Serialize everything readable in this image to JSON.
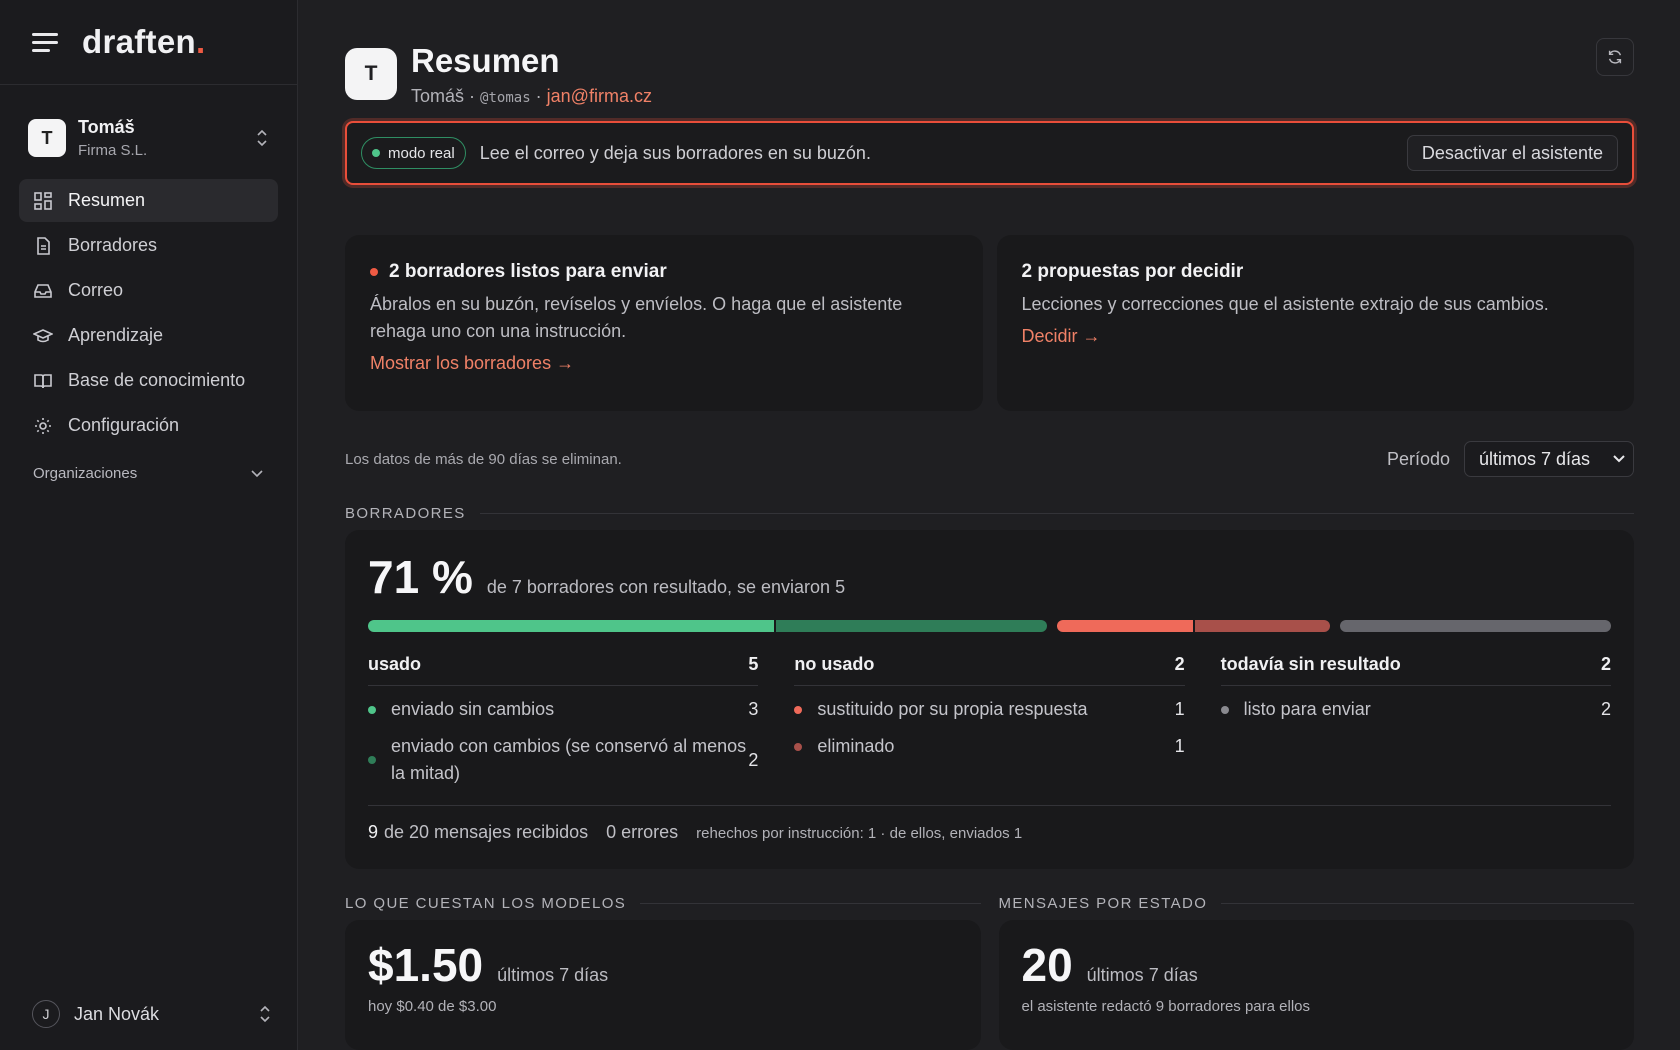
{
  "brand": {
    "name": "draften",
    "dot": "."
  },
  "org": {
    "avatar": "T",
    "name": "Tomáš",
    "company": "Firma S.L."
  },
  "nav": [
    {
      "label": "Resumen",
      "icon": "dashboard-icon"
    },
    {
      "label": "Borradores",
      "icon": "document-icon"
    },
    {
      "label": "Correo",
      "icon": "inbox-icon"
    },
    {
      "label": "Aprendizaje",
      "icon": "graduation-cap-icon"
    },
    {
      "label": "Base de conocimiento",
      "icon": "book-icon"
    },
    {
      "label": "Configuración",
      "icon": "gear-icon"
    }
  ],
  "organizations_label": "Organizaciones",
  "user": {
    "initial": "J",
    "name": "Jan Novák"
  },
  "header": {
    "avatar": "T",
    "title": "Resumen",
    "name": "Tomáš",
    "sep": "·",
    "handle": "@tomas",
    "email": "jan@firma.cz"
  },
  "banner": {
    "mode": "modo real",
    "text": "Lee el correo y deja sus borradores en su buzón.",
    "button": "Desactivar el asistente"
  },
  "cards": [
    {
      "title": "2 borradores listos para enviar",
      "body": "Ábralos en su buzón, revíselos y envíelos. O haga que el asistente rehaga uno con una instrucción.",
      "link": "Mostrar los borradores →"
    },
    {
      "title": "2 propuestas por decidir",
      "body": "Lecciones y correcciones que el asistente extrajo de sus cambios.",
      "link": "Decidir →"
    }
  ],
  "retention": "Los datos de más de 90 días se eliminan.",
  "period": {
    "label": "Período",
    "value": "últimos 7 días"
  },
  "drafts": {
    "section": "BORRADORES",
    "pct": "71 %",
    "pct_desc": "de 7 borradores con resultado, se enviaron 5",
    "bar": [
      {
        "value": 3,
        "color": "#4fc58a"
      },
      {
        "value": 2,
        "color": "#2f7d58"
      },
      {
        "value": 1,
        "color": "#ef6a5a"
      },
      {
        "value": 1,
        "color": "#a8504a"
      },
      {
        "value": 2,
        "color": "#66666c"
      }
    ],
    "groups": [
      {
        "title": "usado",
        "count": "5",
        "rows": [
          {
            "label": "enviado sin cambios",
            "count": "3",
            "color": "#4fc58a"
          },
          {
            "label": "enviado con cambios (se conservó al menos la mitad)",
            "count": "2",
            "color": "#2f7d58"
          }
        ]
      },
      {
        "title": "no usado",
        "count": "2",
        "rows": [
          {
            "label": "sustituido por su propia respuesta",
            "count": "1",
            "color": "#ef6a5a"
          },
          {
            "label": "eliminado",
            "count": "1",
            "color": "#a8504a"
          }
        ]
      },
      {
        "title": "todavía sin resultado",
        "count": "2",
        "rows": [
          {
            "label": "listo para enviar",
            "count": "2",
            "color": "#8a8a90"
          }
        ]
      }
    ],
    "footer": {
      "received_num": "9",
      "received_text": "de 20 mensajes recibidos",
      "errors": "0 errores",
      "redone": "rehechos por instrucción: 1 · de ellos, enviados 1"
    }
  },
  "costs": {
    "section": "LO QUE CUESTAN LOS MODELOS",
    "value": "$1.50",
    "period": "últimos 7 días",
    "sub": "hoy $0.40 de $3.00"
  },
  "messages": {
    "section": "MENSAJES POR ESTADO",
    "value": "20",
    "period": "últimos 7 días",
    "sub": "el asistente redactó 9 borradores para ellos"
  }
}
